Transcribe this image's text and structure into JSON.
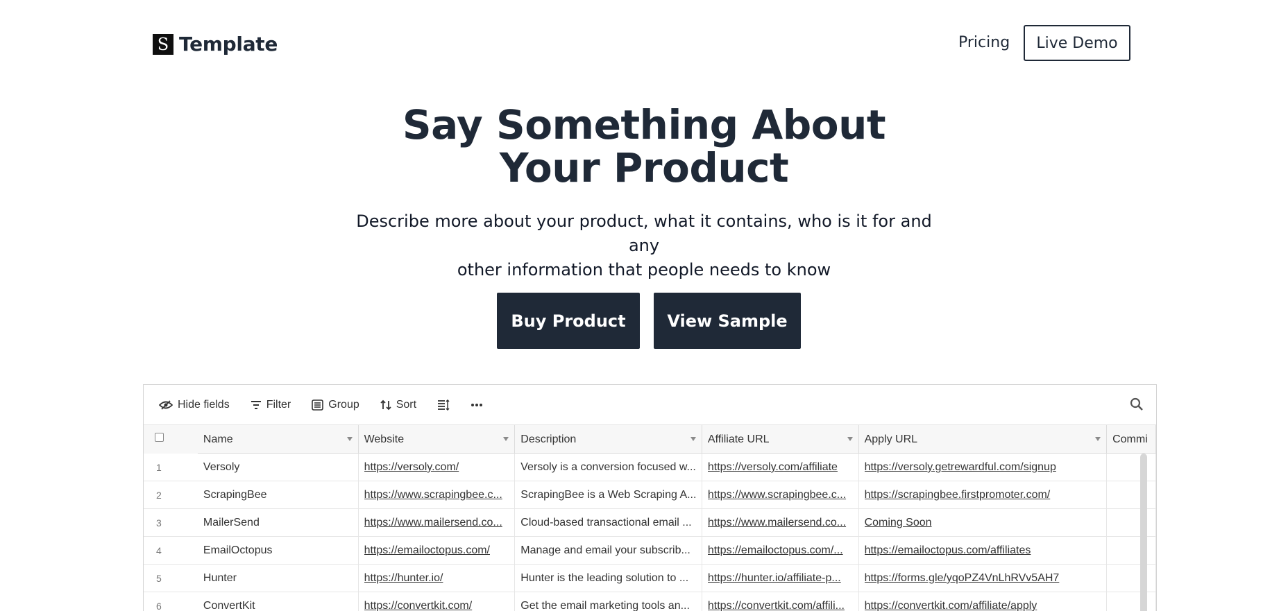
{
  "nav": {
    "logo_letter": "S",
    "logo_text": "Template",
    "pricing_label": "Pricing",
    "demo_label": "Live Demo"
  },
  "hero": {
    "title_line1": "Say Something About",
    "title_line2": "Your Product",
    "subtitle_line1": "Describe more about your product, what it contains, who is it for and any",
    "subtitle_line2": "other information that people needs to know",
    "buy_label": "Buy Product",
    "sample_label": "View Sample"
  },
  "toolbar": {
    "hide_fields": "Hide fields",
    "filter": "Filter",
    "group": "Group",
    "sort": "Sort"
  },
  "table": {
    "columns": [
      "Name",
      "Website",
      "Description",
      "Affiliate URL",
      "Apply URL",
      "Commi"
    ],
    "rows": [
      {
        "num": "1",
        "name": "Versoly",
        "website": "https://versoly.com/",
        "description": "Versoly is a conversion focused w...",
        "affiliate": "https://versoly.com/affiliate",
        "apply": "https://versoly.getrewardful.com/signup"
      },
      {
        "num": "2",
        "name": "ScrapingBee",
        "website": "https://www.scrapingbee.c...",
        "description": "ScrapingBee is a Web Scraping A...",
        "affiliate": "https://www.scrapingbee.c...",
        "apply": "https://scrapingbee.firstpromoter.com/"
      },
      {
        "num": "3",
        "name": "MailerSend",
        "website": "https://www.mailersend.co...",
        "description": "Cloud-based transactional email ...",
        "affiliate": "https://www.mailersend.co...",
        "apply": "Coming Soon"
      },
      {
        "num": "4",
        "name": "EmailOctopus",
        "website": "https://emailoctopus.com/",
        "description": "Manage and email your subscrib...",
        "affiliate": "https://emailoctopus.com/...",
        "apply": "https://emailoctopus.com/affiliates"
      },
      {
        "num": "5",
        "name": "Hunter",
        "website": "https://hunter.io/",
        "description": "Hunter is the leading solution to ...",
        "affiliate": "https://hunter.io/affiliate-p...",
        "apply": "https://forms.gle/yqoPZ4VnLhRVv5AH7"
      },
      {
        "num": "6",
        "name": "ConvertKit",
        "website": "https://convertkit.com/",
        "description": "Get the email marketing tools an...",
        "affiliate": "https://convertkit.com/affili...",
        "apply": "https://convertkit.com/affiliate/apply"
      }
    ]
  },
  "icons": {
    "hide_fields": "eye-slash-icon",
    "filter": "filter-icon",
    "group": "group-icon",
    "sort": "sort-icon",
    "row_height": "row-height-icon",
    "more": "more-icon",
    "search": "search-icon"
  }
}
